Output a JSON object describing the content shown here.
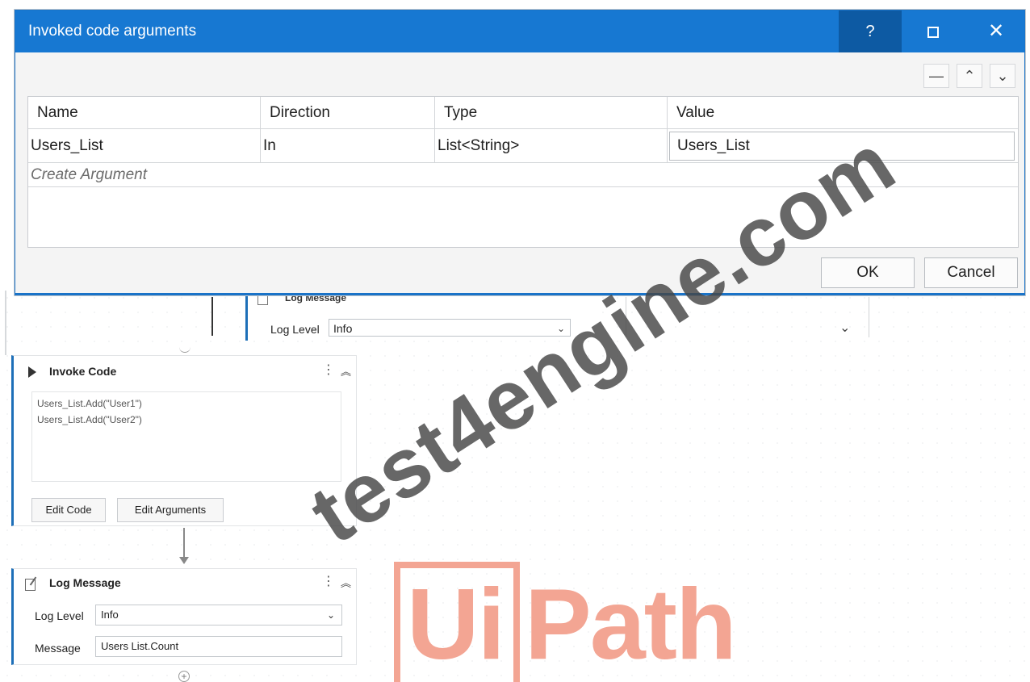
{
  "dialog": {
    "title": "Invoked code arguments",
    "help_label": "?",
    "close_label": "✕",
    "tools": {
      "remove": "—",
      "up": "⌃",
      "down": "⌄"
    },
    "columns": [
      "Name",
      "Direction",
      "Type",
      "Value"
    ],
    "rows": [
      {
        "name": "Users_List",
        "direction": "In",
        "type": "List<String>",
        "value": "Users_List"
      }
    ],
    "create_argument": "Create Argument",
    "ok_label": "OK",
    "cancel_label": "Cancel"
  },
  "background_log_message": {
    "title": "Log Message",
    "log_level_label": "Log Level",
    "log_level_value": "Info"
  },
  "invoke_code": {
    "title": "Invoke Code",
    "code_lines": [
      "Users_List.Add(\"User1\")",
      "Users_List.Add(\"User2\")"
    ],
    "edit_code_label": "Edit Code",
    "edit_arguments_label": "Edit Arguments"
  },
  "log_message": {
    "title": "Log Message",
    "log_level_label": "Log Level",
    "log_level_value": "Info",
    "message_label": "Message",
    "message_value": "Users List.Count"
  },
  "logo": {
    "left": "Ui",
    "right": "Path"
  },
  "watermark": "test4engine.com",
  "icons": {
    "menu": "kebab-menu-icon",
    "collapse": "double-chevron-up-icon",
    "dropdown": "chevron-down-icon",
    "add": "plus-circle-icon"
  },
  "colors": {
    "title_bar": "#1778d2",
    "help_button": "#0d5aa3",
    "logo": "#f3a593",
    "accent": "#1d6fb8"
  }
}
